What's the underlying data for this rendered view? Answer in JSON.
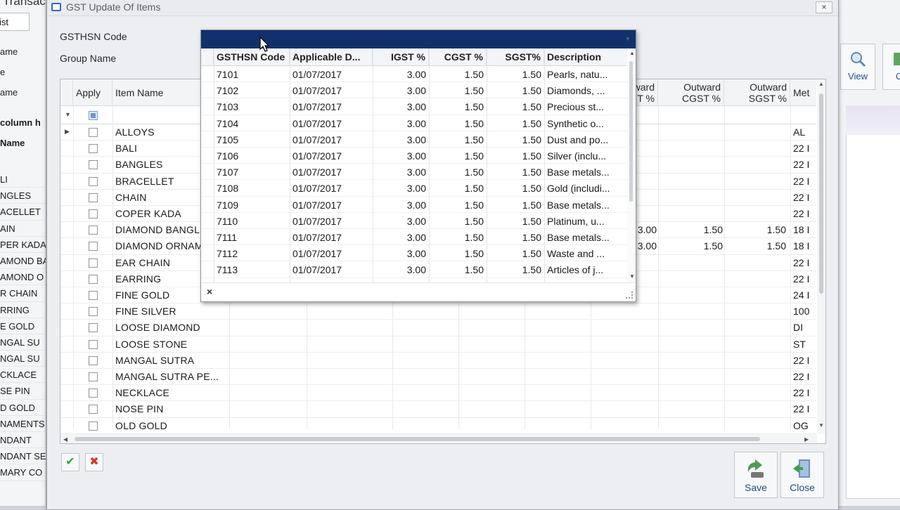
{
  "background": {
    "left_title": "Transac",
    "left_tab": "ist",
    "left_labels": [
      "ame",
      "e",
      "ame"
    ],
    "left_colhdr_1": "column h",
    "left_colhdr_2": "Name",
    "left_list": [
      "LI",
      "NGLES",
      "ACELLET",
      "AIN",
      "PER KADA",
      "AMOND BA",
      "AMOND O",
      "R CHAIN",
      "RRING",
      "E GOLD",
      "NGAL SU",
      "NGAL SU",
      "CKLACE",
      "SE PIN",
      "D GOLD",
      "NAMENTS",
      "NDANT",
      "NDANT SE",
      "MARY CO"
    ],
    "right_buttons": [
      {
        "label": "View",
        "icon": "magnifier-icon"
      },
      {
        "label": "Cl",
        "icon": "exit-icon"
      }
    ]
  },
  "dialog": {
    "title": "GST Update Of Items",
    "close_label": "×",
    "filters": {
      "gsthsn_label": "GSTHSN Code",
      "group_label": "Group Name"
    },
    "grid": {
      "headers": {
        "apply": "Apply",
        "item_name": "Item Name",
        "outward_igst": "ward\nT %",
        "outward_cgst": "Outward\nCGST %",
        "outward_sgst": "Outward\nSGST %",
        "metal": "Met"
      },
      "rows": [
        {
          "name": "ALLOYS",
          "metal": "AL",
          "oi": "",
          "oc": "",
          "os": ""
        },
        {
          "name": "BALI",
          "metal": "22 I",
          "oi": "",
          "oc": "",
          "os": ""
        },
        {
          "name": "BANGLES",
          "metal": "22 I",
          "oi": "",
          "oc": "",
          "os": ""
        },
        {
          "name": "BRACELLET",
          "metal": "22 I",
          "oi": "",
          "oc": "",
          "os": ""
        },
        {
          "name": "CHAIN",
          "metal": "22 I",
          "oi": "",
          "oc": "",
          "os": ""
        },
        {
          "name": "COPER KADA",
          "metal": "22 I",
          "oi": "",
          "oc": "",
          "os": ""
        },
        {
          "name": "DIAMOND BANGL",
          "metal": "18 I",
          "oi": "3.00",
          "oc": "1.50",
          "os": "1.50"
        },
        {
          "name": "DIAMOND ORNAM",
          "metal": "18 I",
          "oi": "3.00",
          "oc": "1.50",
          "os": "1.50"
        },
        {
          "name": "EAR CHAIN",
          "metal": "22 I",
          "oi": "",
          "oc": "",
          "os": ""
        },
        {
          "name": "EARRING",
          "metal": "22 I",
          "oi": "",
          "oc": "",
          "os": ""
        },
        {
          "name": "FINE GOLD",
          "metal": "24 I",
          "oi": "",
          "oc": "",
          "os": ""
        },
        {
          "name": "FINE SILVER",
          "metal": "100",
          "oi": "",
          "oc": "",
          "os": ""
        },
        {
          "name": "LOOSE DIAMOND",
          "metal": "DI",
          "oi": "",
          "oc": "",
          "os": ""
        },
        {
          "name": "LOOSE STONE",
          "metal": "ST",
          "oi": "",
          "oc": "",
          "os": ""
        },
        {
          "name": "MANGAL SUTRA",
          "metal": "22 I",
          "oi": "",
          "oc": "",
          "os": ""
        },
        {
          "name": "MANGAL SUTRA PE...",
          "metal": "22 I",
          "oi": "",
          "oc": "",
          "os": ""
        },
        {
          "name": "NECKLACE",
          "metal": "22 I",
          "oi": "",
          "oc": "",
          "os": ""
        },
        {
          "name": "NOSE PIN",
          "metal": "22 I",
          "oi": "",
          "oc": "",
          "os": ""
        },
        {
          "name": "OLD GOLD",
          "metal": "OG",
          "oi": "",
          "oc": "",
          "os": ""
        }
      ]
    },
    "popup": {
      "headers": {
        "code": "GSTHSN Code",
        "date": "Applicable D...",
        "igst": "IGST %",
        "cgst": "CGST %",
        "sgst": "SGST%",
        "desc": "Description"
      },
      "rows": [
        {
          "code": "7101",
          "date": "01/07/2017",
          "igst": "3.00",
          "cgst": "1.50",
          "sgst": "1.50",
          "desc": "Pearls, natu..."
        },
        {
          "code": "7102",
          "date": "01/07/2017",
          "igst": "3.00",
          "cgst": "1.50",
          "sgst": "1.50",
          "desc": "Diamonds, ..."
        },
        {
          "code": "7103",
          "date": "01/07/2017",
          "igst": "3.00",
          "cgst": "1.50",
          "sgst": "1.50",
          "desc": "Precious st..."
        },
        {
          "code": "7104",
          "date": "01/07/2017",
          "igst": "3.00",
          "cgst": "1.50",
          "sgst": "1.50",
          "desc": "Synthetic o..."
        },
        {
          "code": "7105",
          "date": "01/07/2017",
          "igst": "3.00",
          "cgst": "1.50",
          "sgst": "1.50",
          "desc": "Dust and po..."
        },
        {
          "code": "7106",
          "date": "01/07/2017",
          "igst": "3.00",
          "cgst": "1.50",
          "sgst": "1.50",
          "desc": "Silver (inclu..."
        },
        {
          "code": "7107",
          "date": "01/07/2017",
          "igst": "3.00",
          "cgst": "1.50",
          "sgst": "1.50",
          "desc": "Base metals..."
        },
        {
          "code": "7108",
          "date": "01/07/2017",
          "igst": "3.00",
          "cgst": "1.50",
          "sgst": "1.50",
          "desc": "Gold (includi..."
        },
        {
          "code": "7109",
          "date": "01/07/2017",
          "igst": "3.00",
          "cgst": "1.50",
          "sgst": "1.50",
          "desc": "Base metals..."
        },
        {
          "code": "7110",
          "date": "01/07/2017",
          "igst": "3.00",
          "cgst": "1.50",
          "sgst": "1.50",
          "desc": "Platinum, u..."
        },
        {
          "code": "7111",
          "date": "01/07/2017",
          "igst": "3.00",
          "cgst": "1.50",
          "sgst": "1.50",
          "desc": "Base metals..."
        },
        {
          "code": "7112",
          "date": "01/07/2017",
          "igst": "3.00",
          "cgst": "1.50",
          "sgst": "1.50",
          "desc": "Waste and ..."
        },
        {
          "code": "7113",
          "date": "01/07/2017",
          "igst": "3.00",
          "cgst": "1.50",
          "sgst": "1.50",
          "desc": "Articles of j..."
        }
      ],
      "close_label": "×"
    },
    "buttons": {
      "ok_label": "✔",
      "cancel_label": "✖",
      "save_label": "Save",
      "close_label": "Close"
    }
  },
  "colors": {
    "popup_header": "#10316b",
    "accent": "#1f4f8a",
    "ok": "#3aa33a",
    "cancel": "#d23a2a"
  }
}
